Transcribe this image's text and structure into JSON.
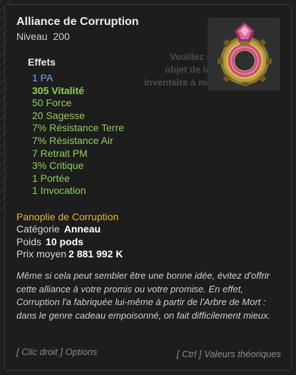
{
  "tooltip": {
    "item_name": "Alliance de Corruption",
    "level_label": "Niveau",
    "level_value": "200",
    "effects_title": "Effets",
    "effects": [
      "1 PA",
      "305 Vitalité",
      "50 Force",
      "20 Sagesse",
      "7% Résistance Terre",
      "7% Résistance Air",
      "7 Retrait PM",
      "3% Critique",
      "1 Portée",
      "1 Invocation"
    ],
    "set_name": "Panoplie de Corruption",
    "category_label": "Catégorie",
    "category_value": "Anneau",
    "weight_label": "Poids",
    "weight_value": "10 pods",
    "price_label": "Prix moyen",
    "price_value": "2 881 992 K",
    "description": "Même si cela peut sembler être une bonne idée, évitez d'offrir cette alliance à votre promis ou votre promise. En effet, Corruption l'a fabriquée lui-même à partir de l'Arbre de Mort : dans le genre cadeau empoisonné, on fait difficilement mieux.",
    "hint_right_click": "[ Clic droit ] Options",
    "hint_ctrl": "[ Ctrl ] Valeurs théoriques"
  },
  "background": {
    "ghost_text_line1": "Veuillez sélectio",
    "ghost_text_line2": "objet de la liste ou",
    "ghost_text_line3": "inventaire à mettre en vente"
  },
  "colors": {
    "effect_green": "#8ed05a",
    "pa_blue": "#7aa8ff",
    "set_gold": "#e6b43a"
  },
  "icons": {
    "item": "ring-icon"
  }
}
